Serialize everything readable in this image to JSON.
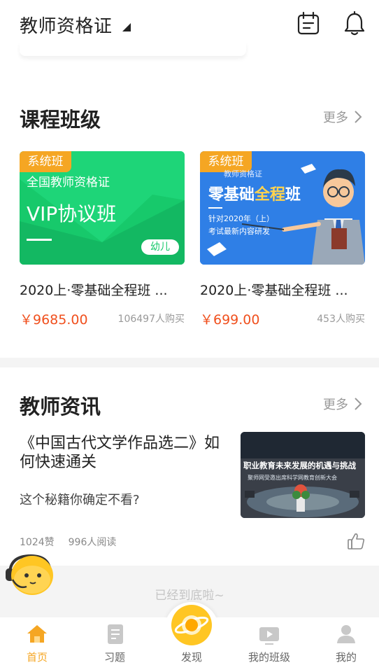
{
  "header": {
    "exam_name": "教师资格证"
  },
  "courses_section": {
    "title": "课程班级",
    "more": "更多",
    "items": [
      {
        "tag": "系统班",
        "thumb_line1": "全国教师资格证",
        "thumb_line2": "VIP协议班",
        "thumb_badge": "幼儿",
        "name": "2020上·零基础全程班 ...",
        "price": "￥9685.00",
        "sold": "106497人购买"
      },
      {
        "tag": "系统班",
        "thumb_line1": "教师资格证",
        "thumb_line2a": "零基础",
        "thumb_line2b": "全程",
        "thumb_line2c": "班",
        "thumb_line3": "针对2020年（上）",
        "thumb_line4": "考试最新内容研发",
        "name": "2020上·零基础全程班 ...",
        "price": "￥699.00",
        "sold": "453人购买"
      }
    ]
  },
  "news_section": {
    "title": "教师资讯",
    "more": "更多",
    "article": {
      "title": "《中国古代文学作品选二》如何快速通关",
      "summary": "这个秘籍你确定不看?",
      "image_caption": "职业教育未来发展的机遇与挑战",
      "image_subcaption": "聚师网受邀出席科学网教育创新大会",
      "likes": "1024赞",
      "reads": "996人阅读"
    }
  },
  "end_text": "已经到底啦~",
  "bottom_nav": {
    "items": [
      {
        "label": "首页",
        "icon": "home-icon"
      },
      {
        "label": "习题",
        "icon": "exercise-icon"
      },
      {
        "label": "发现",
        "icon": "discover-planet-icon"
      },
      {
        "label": "我的班级",
        "icon": "video-class-icon"
      },
      {
        "label": "我的",
        "icon": "profile-icon"
      }
    ]
  },
  "colors": {
    "accent": "#f5a623",
    "price": "#f0501e",
    "green_thumb": "#17c96b",
    "blue_thumb": "#2f7fe6"
  }
}
